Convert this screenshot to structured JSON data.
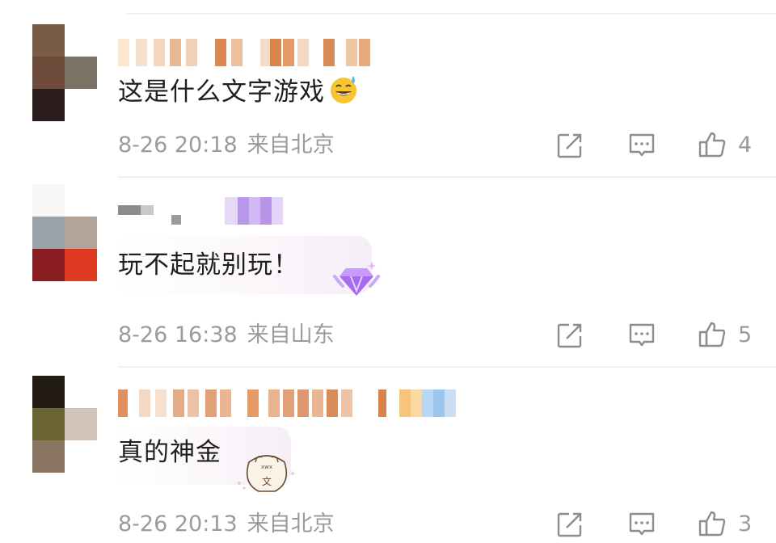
{
  "colors": {
    "meta_text": "#9b9b9b",
    "body_text": "#1f1f1f",
    "divider": "#f1f1f1",
    "icon_stroke": "#8d8d8d",
    "badge_purple": "#a86bf0"
  },
  "comments": [
    {
      "username": "",
      "text": "这是什么文字游戏",
      "emoji": "😅",
      "date": "8-26 20:18",
      "location": "来自北京",
      "likes": "4",
      "icons": [
        "share-icon",
        "comment-icon",
        "like-icon"
      ]
    },
    {
      "username": "",
      "text": "玩不起就别玩！",
      "date": "8-26 16:38",
      "location": "来自山东",
      "likes": "5",
      "badge_icon": "purple-diamond-badge-icon",
      "icons": [
        "share-icon",
        "comment-icon",
        "like-icon"
      ]
    },
    {
      "username": "",
      "text": "真的神金",
      "date": "8-26 20:13",
      "location": "来自北京",
      "likes": "3",
      "badge_icon": "bunny-sticker-icon",
      "icons": [
        "share-icon",
        "comment-icon",
        "like-icon"
      ]
    }
  ]
}
